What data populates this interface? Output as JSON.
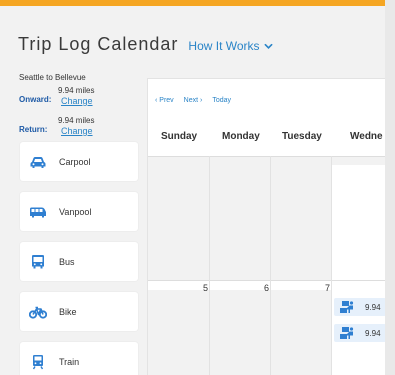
{
  "header": {
    "title": "Trip Log Calendar",
    "how_it_works": "How It Works"
  },
  "trip": {
    "route": "Seattle to Bellevue",
    "onward": {
      "label": "Onward:",
      "miles": "9.94 miles",
      "change": "Change"
    },
    "return": {
      "label": "Return:",
      "miles": "9.94 miles",
      "change": "Change"
    }
  },
  "modes": [
    {
      "label": "Carpool",
      "icon": "car-icon"
    },
    {
      "label": "Vanpool",
      "icon": "van-icon"
    },
    {
      "label": "Bus",
      "icon": "bus-icon"
    },
    {
      "label": "Bike",
      "icon": "bike-icon"
    },
    {
      "label": "Train",
      "icon": "train-icon"
    }
  ],
  "calendar": {
    "nav": {
      "prev": "‹ Prev",
      "next": "Next ›",
      "today": "Today"
    },
    "days": [
      "Sunday",
      "Monday",
      "Tuesday",
      "Wedne"
    ],
    "week2_dates": [
      "5",
      "6",
      "7"
    ],
    "entries": [
      {
        "icon": "telework-icon",
        "miles": "9.94"
      },
      {
        "icon": "telework-icon",
        "miles": "9.94"
      }
    ]
  },
  "colors": {
    "accent": "#f5a623",
    "link": "#2a84c7",
    "icon_blue": "#2f7fd1",
    "label_blue": "#1e5aa6"
  }
}
